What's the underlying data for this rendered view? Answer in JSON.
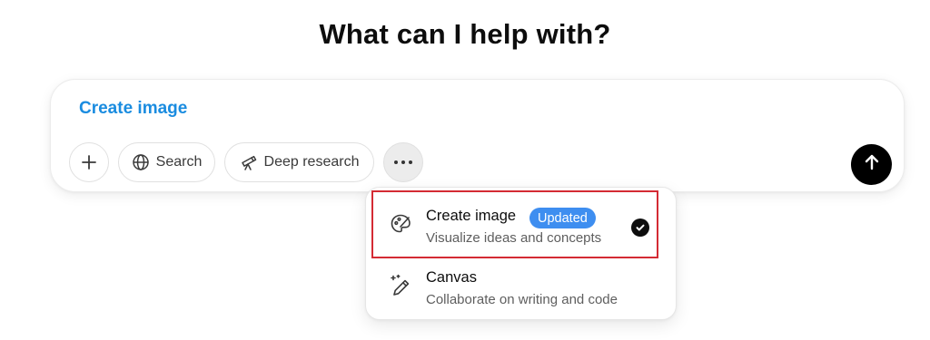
{
  "heading": "What can I help with?",
  "composer": {
    "mode_label": "Create image",
    "mode_color": "#1a8ce0",
    "tools": {
      "add_icon": "plus-icon",
      "search_label": "Search",
      "search_icon": "globe-icon",
      "deep_research_label": "Deep research",
      "deep_research_icon": "telescope-icon",
      "more_icon": "ellipsis-icon"
    },
    "send_icon": "arrow-up-icon"
  },
  "menu": {
    "items": [
      {
        "title": "Create image",
        "badge": "Updated",
        "subtitle": "Visualize ideas and concepts",
        "icon": "palette-icon",
        "selected": true,
        "highlighted": true
      },
      {
        "title": "Canvas",
        "subtitle": "Collaborate on writing and code",
        "icon": "pen-sparkle-icon",
        "selected": false
      }
    ],
    "badge_color": "#3e8ef0",
    "highlight_color": "#d42b34"
  }
}
